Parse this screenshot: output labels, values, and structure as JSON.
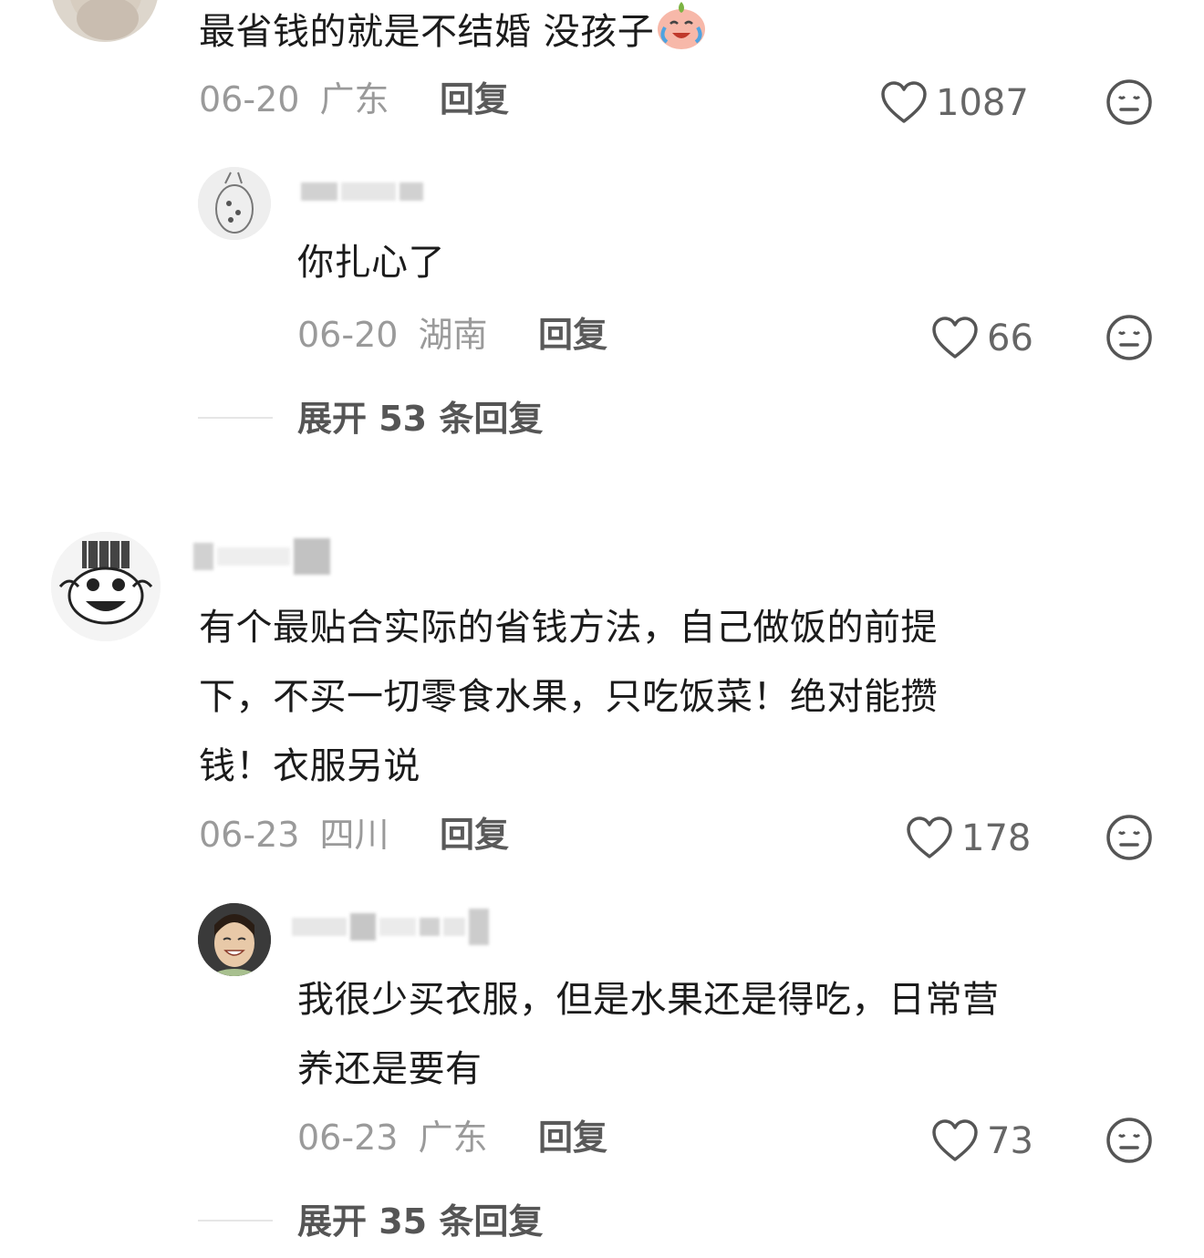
{
  "comments": [
    {
      "text": "最省钱的就是不结婚 没孩子",
      "emoji": "crying-laughing-peach-emoji",
      "date": "06-20",
      "location": "广东",
      "reply_label": "回复",
      "likes": "1087",
      "replies": [
        {
          "text": "你扎心了",
          "date": "06-20",
          "location": "湖南",
          "reply_label": "回复",
          "likes": "66"
        }
      ],
      "expand_label": "展开 53 条回复"
    },
    {
      "text_line1": "有个最贴合实际的省钱方法，自己做饭的前提",
      "text_line2": "下，不买一切零食水果，只吃饭菜！绝对能攒",
      "text_line3": "钱！衣服另说",
      "date": "06-23",
      "location": "四川",
      "reply_label": "回复",
      "likes": "178",
      "replies": [
        {
          "text_line1": "我很少买衣服，但是水果还是得吃，日常营",
          "text_line2": "养还是要有",
          "date": "06-23",
          "location": "广东",
          "reply_label": "回复",
          "likes": "73"
        }
      ],
      "expand_label": "展开 35 条回复"
    }
  ],
  "icons": {
    "like": "heart-outline-icon",
    "dislike": "neutral-face-icon"
  },
  "colors": {
    "text": "#1b1b1b",
    "meta": "#9a9a9a",
    "action": "#5a5a5a",
    "divider": "#e6e6e6"
  }
}
